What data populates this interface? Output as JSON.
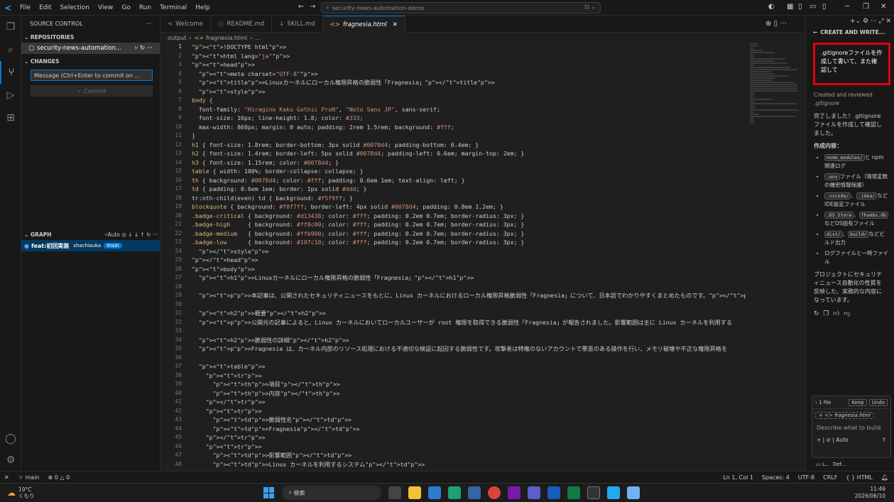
{
  "titlebar": {
    "logo": "≺",
    "menu": [
      "File",
      "Edit",
      "Selection",
      "View",
      "Go",
      "Run",
      "Terminal",
      "Help"
    ],
    "search": "security-news-automation-demo"
  },
  "sidebar": {
    "header": "SOURCE CONTROL",
    "repositories_title": "REPOSITORIES",
    "repo_name": "security-news-automation...",
    "repo_branch": "main",
    "changes_title": "CHANGES",
    "commit_placeholder": "Message (Ctrl+Enter to commit on ...",
    "commit_button": "✓ Commit",
    "graph_title": "GRAPH",
    "graph_auto": "Auto",
    "graph_commit": "feat:初回実装",
    "graph_author": "shachisuka",
    "graph_branch": "main"
  },
  "tabs": [
    {
      "label": "Welcome",
      "icon": "≺"
    },
    {
      "label": "README.md",
      "icon": "ⓘ"
    },
    {
      "label": "SKILL.md",
      "icon": "↓"
    },
    {
      "label": "fragnesia.html",
      "icon": "<>"
    }
  ],
  "breadcrumb": {
    "folder": "output",
    "file": "fragnesia.html",
    "rest": "..."
  },
  "chat": {
    "title": "CREATE AND WRITE...",
    "user_message": ".gitignoreファイルを作成して書いて、また確認して",
    "created_label": "Created and reviewed",
    "created_file": ".gitignore",
    "done_text": "完了しました！.gitignoreファイルを作成して確認しました。",
    "contents_title": "作成内容：",
    "items": [
      {
        "code": [
          "node_modules/"
        ],
        "text": "と npm 関連ログ"
      },
      {
        "code": [
          ".env"
        ],
        "text": "ファイル（環境変数の機密情報保護）"
      },
      {
        "code": [
          ".vscode/",
          ".idea/"
        ],
        "text": "などIDE設定ファイル"
      },
      {
        "code": [
          ".DS_Store",
          "Thumbs.db"
        ],
        "text": "などOS固有ファイル"
      },
      {
        "code": [
          "dist/",
          "build/"
        ],
        "text": "などビルド出力"
      },
      {
        "code": [],
        "text": "ログファイルと一時ファイル"
      }
    ],
    "summary": "プロジェクトにセキュリティニュース自動化の性質を反映した、実務的な内容になっています。",
    "files_changed": "1 file",
    "keep": "Keep",
    "undo": "Undo",
    "file_chip": "fragnesia.html",
    "input_placeholder": "Describe what to build",
    "auto": "Auto",
    "bottom_label": "Def..."
  },
  "statusbar": {
    "branch": "main",
    "problems": "⊗ 0 △ 0",
    "position": "Ln 1, Col 1",
    "spaces": "Spaces: 4",
    "encoding": "UTF-8",
    "eol": "CRLF",
    "language": "{ } HTML"
  },
  "taskbar": {
    "weather": "19°C",
    "weather_desc": "くもり",
    "search": "検索",
    "time": "11:46",
    "date": "2026/06/10"
  },
  "code": [
    "<!DOCTYPE html>",
    "<html lang=\"ja\">",
    "<head>",
    "  <meta charset=\"UTF-8\">",
    "  <title>Linuxカーネルにローカル権限昇格の脆弱性「Fragnesia」</title>",
    "  <style>",
    "body {",
    "  font-family: \"Hiragino Kaku Gothic ProN\", \"Noto Sans JP\", sans-serif;",
    "  font-size: 16px; line-height: 1.8; color: #333;",
    "  max-width: 860px; margin: 0 auto; padding: 2rem 1.5rem; background: #fff;",
    "}",
    "h1 { font-size: 1.8rem; border-bottom: 3px solid #0078d4; padding-bottom: 0.4em; }",
    "h2 { font-size: 1.4rem; border-left: 5px solid #0078d4; padding-left: 0.6em; margin-top: 2em; }",
    "h3 { font-size: 1.15rem; color: #0078d4; }",
    "table { width: 100%; border-collapse: collapse; }",
    "th { background: #0078d4; color: #fff; padding: 0.6em 1em; text-align: left; }",
    "td { padding: 0.6em 1em; border: 1px solid #ddd; }",
    "tr:nth-child(even) td { background: #f5f9ff; }",
    "blockquote { background: #f0f7ff; border-left: 4px solid #0078d4; padding: 0.8em 1.2em; }",
    ".badge-critical { background: #d13438; color: #fff; padding: 0.2em 0.7em; border-radius: 3px; }",
    ".badge-high     { background: #ff8c00; color: #fff; padding: 0.2em 0.7em; border-radius: 3px; }",
    ".badge-medium   { background: #ffb900; color: #fff; padding: 0.2em 0.7em; border-radius: 3px; }",
    ".badge-low      { background: #107c10; color: #fff; padding: 0.2em 0.7em; border-radius: 3px; }",
    "  </style>",
    "</head>",
    "<body>",
    "  <h1>Linuxカーネルにローカル権限昇格の脆弱性「Fragnesia」</h1>",
    "",
    "  <p>本記事は、公開されたセキュリティニュースをもとに、Linux カーネルにおけるローカル権限昇格脆弱性「Fragnesia」について、日本語でわかりやすくまとめたものです。</p>",
    "",
    "  <h2>概要</h2>",
    "  <p>公開元の記事によると、Linux カーネルにおいてローカルユーザーが root 権限を取得できる脆弱性「Fragnesia」が報告されました。影響範囲は主に Linux カーネルを利用する",
    "",
    "  <h2>脆弱性の詳細</h2>",
    "  <p>Fragnesia は、カーネル内部のリソース処理における不適切な検証に起因する脆弱性です。攻撃者は特権のないアカウントで悪意のある操作を行い、メモリ破壊や不正な権限昇格を",
    "",
    "  <table>",
    "    <tr>",
    "      <th>項目</th>",
    "      <th>内容</th>",
    "    </tr>",
    "    <tr>",
    "      <td>脆弱性名</td>",
    "      <td>Fragnesia</td>",
    "    </tr>",
    "    <tr>",
    "      <td>影響範囲</td>",
    "      <td>Linux カーネルを利用するシステム</td>"
  ],
  "colors": {
    "accent": "#0078d4",
    "highlight": "#e0000f"
  }
}
